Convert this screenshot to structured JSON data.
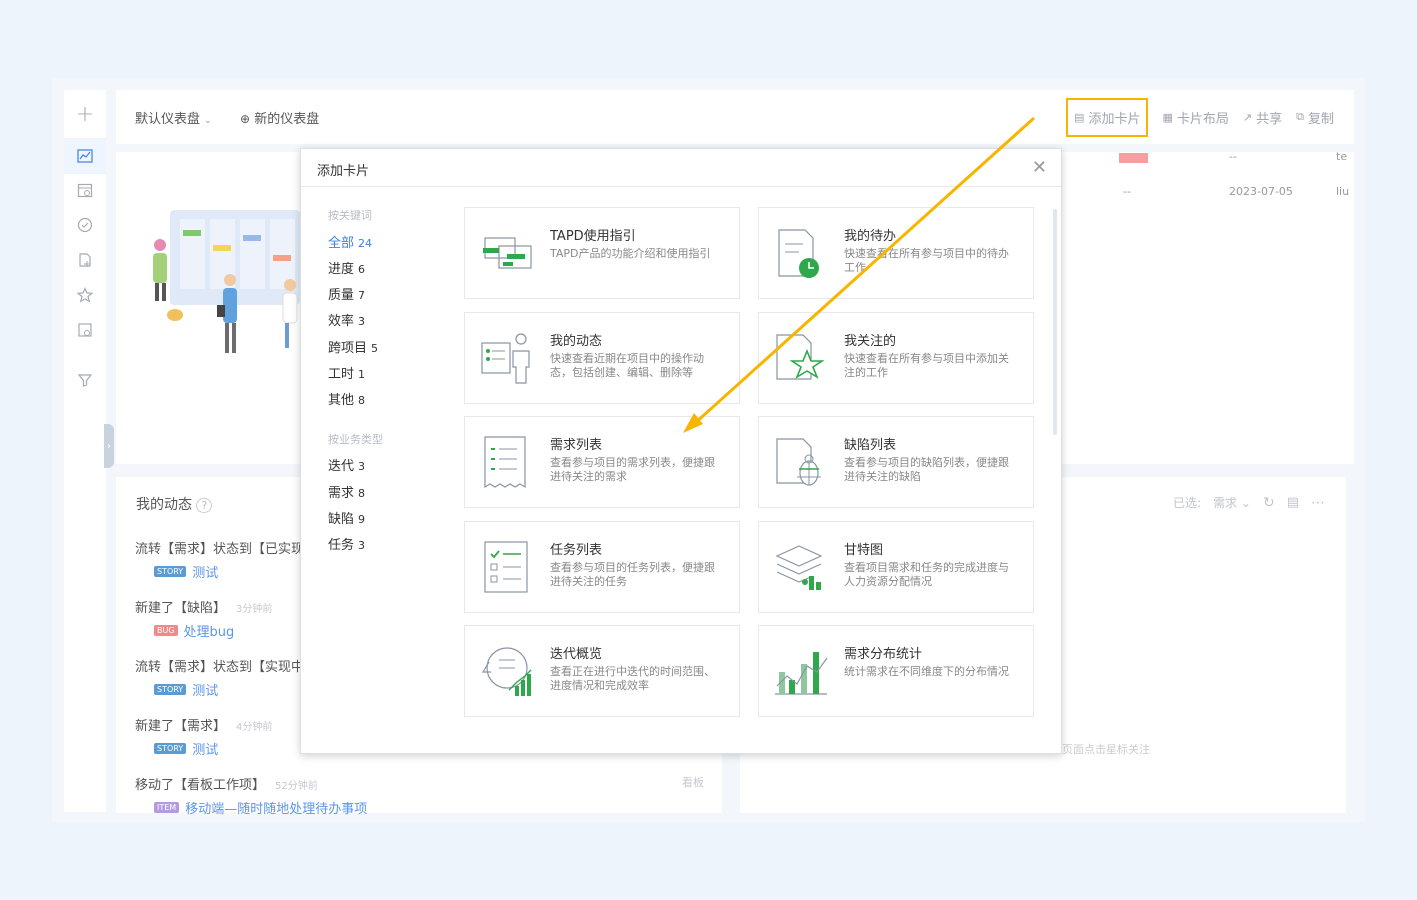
{
  "topbar": {
    "dashboard": "默认仪表盘",
    "new_dashboard": "新的仪表盘",
    "actions": [
      "添加卡片",
      "卡片布局",
      "共享",
      "复制"
    ]
  },
  "bg_rows": {
    "r1_mid": "--",
    "r1_right": "te",
    "r2_mid": "--",
    "r2_date": "2023-07-05",
    "r2_right": "liu"
  },
  "activity": {
    "title": "我的动态",
    "items": [
      {
        "text": "流转【需求】状态到【已实现",
        "time": "",
        "tag": "STORY",
        "tag_class": "story",
        "sub": "测试"
      },
      {
        "text": "新建了【缺陷】",
        "time": "3分钟前",
        "tag": "BUG",
        "tag_class": "bug",
        "sub": "处理bug"
      },
      {
        "text": "流转【需求】状态到【实现中",
        "time": "",
        "tag": "STORY",
        "tag_class": "story",
        "sub": "测试"
      },
      {
        "text": "新建了【需求】",
        "time": "4分钟前",
        "tag": "STORY",
        "tag_class": "story",
        "sub": "测试"
      },
      {
        "text": "移动了【看板工作项】",
        "time": "52分钟前",
        "tag": "ITEM",
        "tag_class": "item",
        "sub": "移动端—随时随地处理待办事项"
      }
    ],
    "kanban": "看板"
  },
  "right_panel": {
    "selected_label": "已选:",
    "selected_value": "需求",
    "hint": "页面点击星标关注"
  },
  "modal": {
    "title": "添加卡片",
    "group_keyword": "按关键词",
    "keywords": [
      {
        "label": "全部",
        "count": "24"
      },
      {
        "label": "进度",
        "count": "6"
      },
      {
        "label": "质量",
        "count": "7"
      },
      {
        "label": "效率",
        "count": "3"
      },
      {
        "label": "跨项目",
        "count": "5"
      },
      {
        "label": "工时",
        "count": "1"
      },
      {
        "label": "其他",
        "count": "8"
      }
    ],
    "group_business": "按业务类型",
    "business": [
      {
        "label": "迭代",
        "count": "3"
      },
      {
        "label": "需求",
        "count": "8"
      },
      {
        "label": "缺陷",
        "count": "9"
      },
      {
        "label": "任务",
        "count": "3"
      }
    ],
    "cards": [
      {
        "title": "TAPD使用指引",
        "desc": "TAPD产品的功能介绍和使用指引"
      },
      {
        "title": "我的待办",
        "desc": "快速查看在所有参与项目中的待办工作"
      },
      {
        "title": "我的动态",
        "desc": "快速查看近期在项目中的操作动态，包括创建、编辑、删除等"
      },
      {
        "title": "我关注的",
        "desc": "快速查看在所有参与项目中添加关注的工作"
      },
      {
        "title": "需求列表",
        "desc": "查看参与项目的需求列表，便捷跟进待关注的需求"
      },
      {
        "title": "缺陷列表",
        "desc": "查看参与项目的缺陷列表，便捷跟进待关注的缺陷"
      },
      {
        "title": "任务列表",
        "desc": "查看参与项目的任务列表，便捷跟进待关注的任务"
      },
      {
        "title": "甘特图",
        "desc": "查看项目需求和任务的完成进度与人力资源分配情况"
      },
      {
        "title": "迭代概览",
        "desc": "查看正在进行中迭代的时间范围、进度情况和完成效率"
      },
      {
        "title": "需求分布统计",
        "desc": "统计需求在不同维度下的分布情况"
      }
    ]
  },
  "colors": {
    "accent": "#3f7fdf",
    "highlight": "#f8b500",
    "green": "#2ea84a"
  }
}
